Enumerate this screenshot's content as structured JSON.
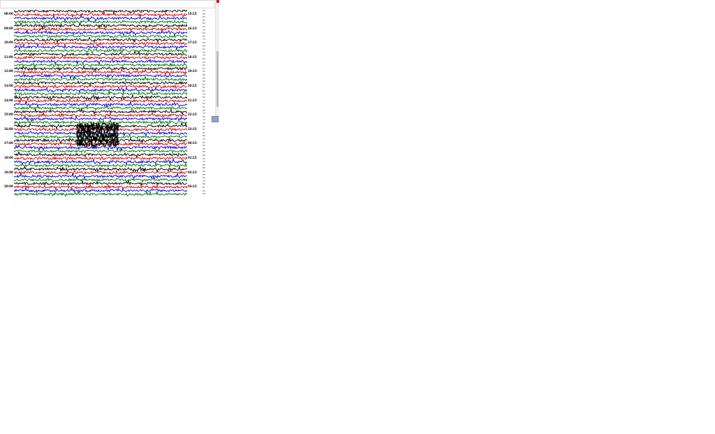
{
  "viewer": {
    "title": "",
    "left_time_labels": [
      "08:00",
      "09:00",
      "10:00",
      "11:00",
      "12:00",
      "13:00",
      "14:00",
      "15:00",
      "16:00",
      "17:00",
      "18:00",
      "19:00",
      "20:00"
    ],
    "right_time_labels": [
      "15:15",
      "16:15",
      "17:15",
      "18:15",
      "19:15",
      "20:15",
      "21:15",
      "22:15",
      "23:15",
      "00:15",
      "01:15",
      "02:15",
      "03:15"
    ],
    "amplitude_labels": [
      "93",
      "85",
      "83",
      "85",
      "80",
      "91",
      "73",
      "84",
      "85",
      "79",
      "85",
      "83",
      "97",
      "92",
      "79",
      "82",
      "93",
      "82",
      "84",
      "93",
      "86",
      "84",
      "88",
      "85",
      "82",
      "83",
      "79",
      "82",
      "74",
      "82",
      "81",
      "86",
      "78",
      "89",
      "79",
      "88",
      "82",
      "81",
      "83",
      "86",
      "79",
      "84",
      "85",
      "76",
      "83",
      "88",
      "80",
      "79",
      "84",
      "86",
      "80",
      "88",
      "82",
      "75",
      "89",
      "81",
      "84",
      "86"
    ]
  },
  "colors": {
    "trace_cycle": [
      "#000000",
      "#e00000",
      "#0000e0",
      "#008000"
    ],
    "scroll_marker": "#e01010",
    "side_button": "#8fa6bf"
  },
  "icons": {
    "scrollbar": "scrollbar",
    "corner_marker": "red-marker-icon",
    "side_button": "expand-button-icon"
  }
}
